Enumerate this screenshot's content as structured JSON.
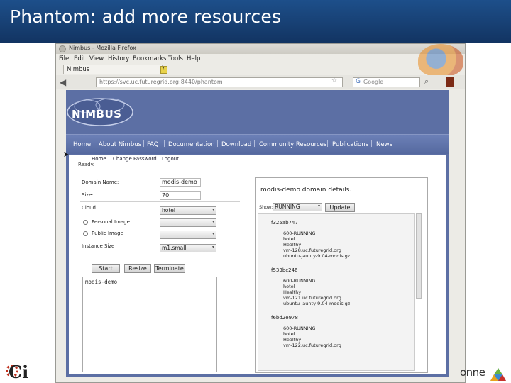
{
  "slide": {
    "title": "Phantom: add more resources"
  },
  "browser": {
    "window_title": "Nimbus - Mozilla Firefox",
    "menu": [
      "File",
      "Edit",
      "View",
      "History",
      "Bookmarks",
      "Tools",
      "Help"
    ],
    "tab_label": "Nimbus",
    "url": "https://svc.uc.futuregrid.org:8440/phantom",
    "search_placeholder": "Google"
  },
  "site": {
    "logo_text": "NIMBUS",
    "nav": [
      "Home",
      "About Nimbus",
      "FAQ",
      "Documentation",
      "Download",
      "Community Resources",
      "Publications",
      "News"
    ],
    "subnav": {
      "home": "Home",
      "change_password": "Change Password",
      "logout": "Logout"
    },
    "status": "Ready."
  },
  "form": {
    "domain_name_label": "Domain Name:",
    "domain_name_value": "modis-demo",
    "size_label": "Size:",
    "size_value": "70",
    "cloud_label": "Cloud",
    "cloud_value": "hotel",
    "personal_image_label": "Personal Image",
    "public_image_label": "Public Image",
    "instance_size_label": "Instance Size",
    "instance_size_value": "m1.small",
    "start_label": "Start",
    "resize_label": "Resize",
    "terminate_label": "Terminate",
    "console_text": "modis-demo"
  },
  "details": {
    "title": "modis-demo domain details.",
    "show_label": "Show:",
    "show_value": "RUNNING",
    "update_label": "Update",
    "vms": [
      {
        "id": "f325ab747",
        "state": "600-RUNNING",
        "cloud": "hotel",
        "health": "Healthy",
        "host": "vm-128.uc.futuregrid.org",
        "image": "ubuntu-jaunty-9.04-modis.gz"
      },
      {
        "id": "f533bc246",
        "state": "600-RUNNING",
        "cloud": "hotel",
        "health": "Healthy",
        "host": "vm-121.uc.futuregrid.org",
        "image": "ubuntu-jaunty-9.04-modis.gz"
      },
      {
        "id": "f6bd2e978",
        "state": "600-RUNNING",
        "cloud": "hotel",
        "health": "Healthy",
        "host": "vm-122.uc.futuregrid.org",
        "image": ""
      }
    ]
  },
  "footer": {
    "ci_logo": "Ci",
    "argonne_text": "onne"
  },
  "colors": {
    "title_bar": "#1a4780",
    "page_bg": "#5c6fa4",
    "nav_bg": "#6276ab"
  }
}
